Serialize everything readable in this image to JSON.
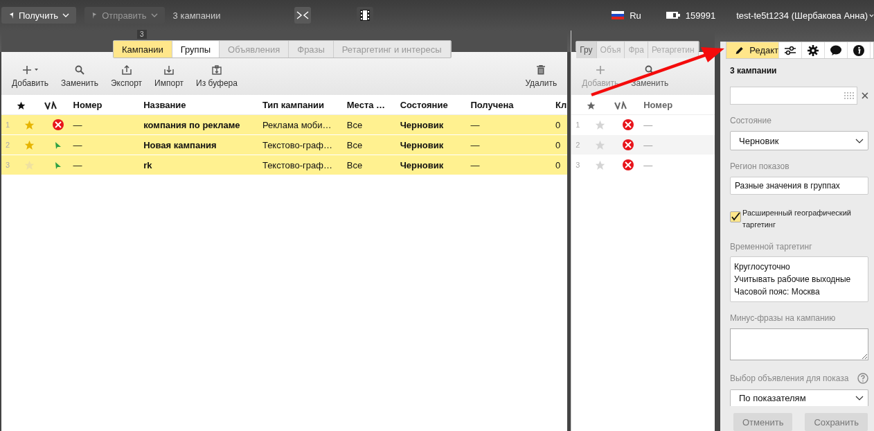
{
  "top_bar": {
    "receive_button": "Получить",
    "send_button": {
      "label": "Отправить",
      "disabled": true
    },
    "selection": "3 кампании",
    "language": "Ru",
    "balance": "159991",
    "user": "test-te5t1234 (Шербакова Анна)"
  },
  "main": {
    "tab_badge": "3",
    "tabs": [
      {
        "label": "Кампании",
        "selected": true,
        "disabled": false
      },
      {
        "label": "Группы",
        "selected": false,
        "disabled": false
      },
      {
        "label": "Объявления",
        "selected": false,
        "disabled": true
      },
      {
        "label": "Фразы",
        "selected": false,
        "disabled": true
      },
      {
        "label": "Ретаргетинг и интересы",
        "selected": false,
        "disabled": true
      }
    ],
    "toolbar": [
      {
        "kind": "add",
        "label": "Добавить"
      },
      {
        "kind": "replace",
        "label": "Заменить"
      },
      {
        "kind": "export",
        "label": "Экспорт"
      },
      {
        "kind": "import",
        "label": "Импорт"
      },
      {
        "kind": "clipboard",
        "label": "Из буфера"
      }
    ],
    "delete_button": "Удалить",
    "columns": [
      "Номер",
      "Название",
      "Тип кампании",
      "Места …",
      "Состояние",
      "Получена",
      "Кл"
    ],
    "rows": [
      {
        "index": "1",
        "selected": true,
        "starred": true,
        "stopped": true,
        "number": "—",
        "name": "компания по рекламе",
        "type": "Реклама моби…",
        "places": "Все",
        "state": "Черновик",
        "received": "—",
        "clicks": "0"
      },
      {
        "index": "2",
        "selected": true,
        "starred": true,
        "stopped": false,
        "number": "—",
        "name": "Новая кампания",
        "type": "Текстово-граф…",
        "places": "Все",
        "state": "Черновик",
        "received": "—",
        "clicks": "0"
      },
      {
        "index": "3",
        "selected": true,
        "starred": false,
        "stopped": false,
        "number": "—",
        "name": "rk",
        "type": "Текстово-граф…",
        "places": "Все",
        "state": "Черновик",
        "received": "—",
        "clicks": "0"
      }
    ]
  },
  "secondary": {
    "tabs": [
      {
        "label": "Гру",
        "selected": true
      },
      {
        "label": "Объя",
        "selected": false
      },
      {
        "label": "Фра",
        "selected": false
      },
      {
        "label": "Ретаргетин",
        "selected": false
      }
    ],
    "toolbar": [
      {
        "kind": "add",
        "label": "Добавить",
        "disabled": true
      },
      {
        "kind": "replace",
        "label": "Заменить",
        "disabled": false
      }
    ],
    "columns": [
      "Номер"
    ],
    "rows": [
      {
        "index": "1",
        "starred": false,
        "stopped": true,
        "number": "—"
      },
      {
        "index": "2",
        "starred": false,
        "stopped": true,
        "number": "—"
      },
      {
        "index": "3",
        "starred": false,
        "stopped": true,
        "number": "—"
      }
    ]
  },
  "editor": {
    "tabs": [
      {
        "kind": "edit",
        "label": "Редакт",
        "selected": true
      },
      {
        "kind": "settings-sliders",
        "selected": false
      },
      {
        "kind": "gear",
        "selected": false
      },
      {
        "kind": "chat",
        "selected": false
      },
      {
        "kind": "info",
        "selected": false
      }
    ],
    "title": "3 кампании",
    "state_label": "Состояние",
    "state_value": "Черновик",
    "region_label": "Регион показов",
    "region_value": "Разные значения в группах",
    "geo_checkbox": {
      "label": "Расширенный географический таргетинг",
      "checked": true
    },
    "time_label": "Временной таргетинг",
    "time_lines": [
      "Круглосуточно",
      "Учитывать рабочие выходные",
      "Часовой пояс: Москва"
    ],
    "minus_label": "Минус-фразы на кампанию",
    "ad_choice_label": "Выбор объявления для показа",
    "ad_choice_value": "По показателям",
    "cancel_button": "Отменить",
    "save_button": "Сохранить"
  }
}
